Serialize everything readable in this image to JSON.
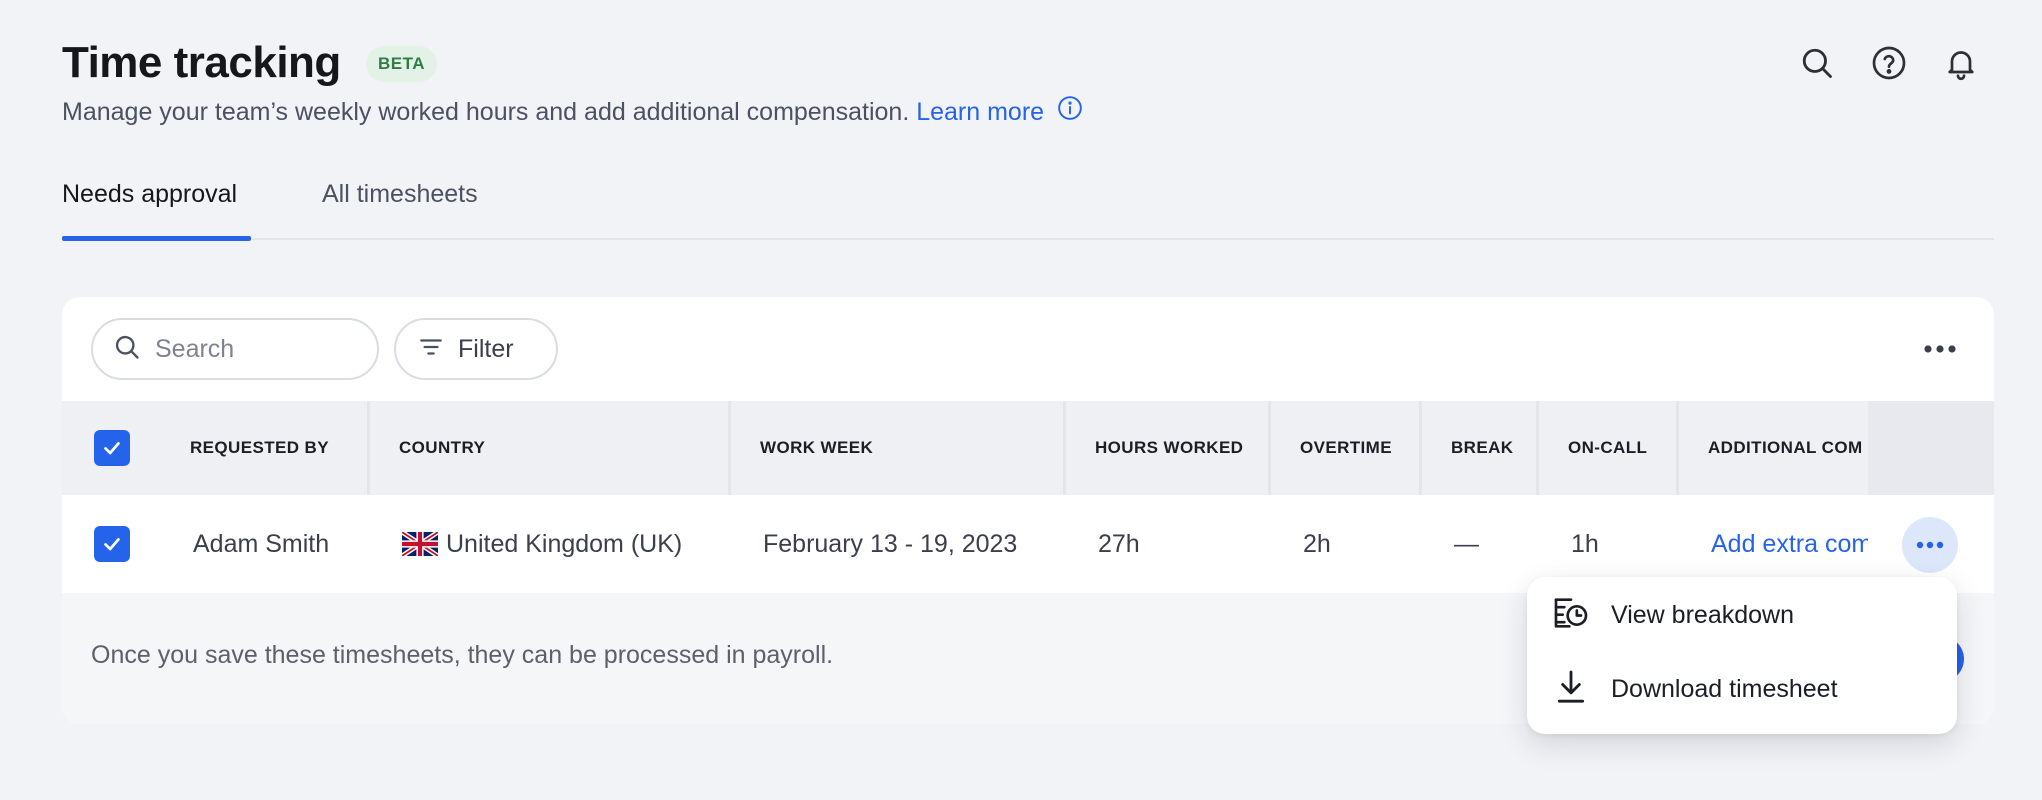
{
  "header": {
    "title": "Time tracking",
    "badge": "BETA",
    "subtitle": "Manage your team’s weekly worked hours and add additional compensation.",
    "learn_more": "Learn more",
    "icons": [
      "search-icon",
      "help-icon",
      "bell-icon"
    ]
  },
  "tabs": [
    {
      "label": "Needs approval",
      "active": true
    },
    {
      "label": "All timesheets",
      "active": false
    }
  ],
  "toolbar": {
    "search_placeholder": "Search",
    "filter_label": "Filter"
  },
  "table": {
    "columns": [
      "REQUESTED BY",
      "COUNTRY",
      "WORK WEEK",
      "HOURS WORKED",
      "OVERTIME",
      "BREAK",
      "ON-CALL",
      "ADDITIONAL COM"
    ],
    "select_all_checked": true,
    "rows": [
      {
        "checked": true,
        "requested_by": "Adam Smith",
        "country": "United Kingdom (UK)",
        "country_flag": "uk-flag-icon",
        "work_week": "February 13 - 19, 2023",
        "hours_worked": "27h",
        "overtime": "2h",
        "break": "—",
        "on_call": "1h",
        "additional_comp": "Add extra com"
      }
    ]
  },
  "footer": {
    "text": "Once you save these timesheets, they can be processed in payroll."
  },
  "row_menu": {
    "items": [
      {
        "label": "View breakdown",
        "icon": "list-clock-icon"
      },
      {
        "label": "Download timesheet",
        "icon": "download-icon"
      }
    ]
  },
  "colors": {
    "accent": "#2563eb",
    "background": "#f2f3f7",
    "beta_bg": "#e3f1e6",
    "beta_text": "#2f7d46"
  }
}
